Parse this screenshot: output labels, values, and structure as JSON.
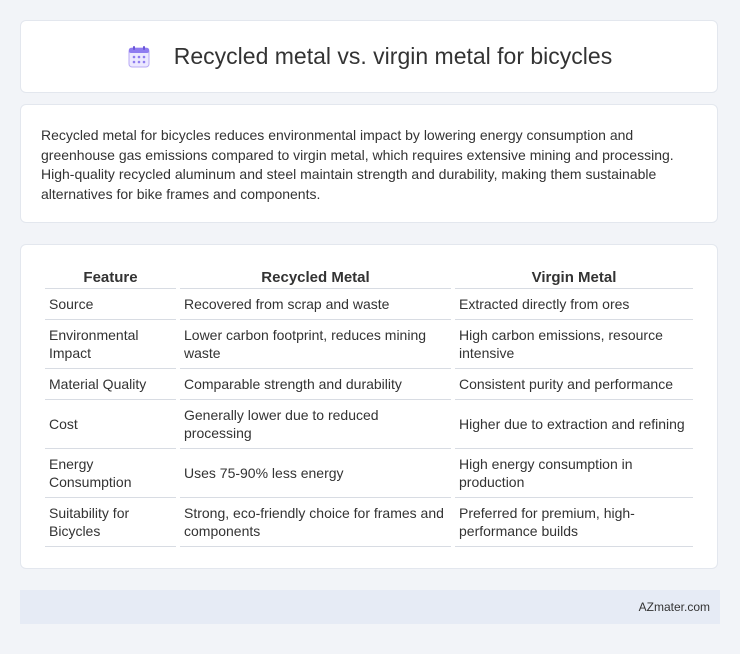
{
  "header": {
    "title": "Recycled metal vs. virgin metal for bicycles",
    "icon": "calendar-icon",
    "icon_color": "#7b61ff"
  },
  "summary": {
    "text": "Recycled metal for bicycles reduces environmental impact by lowering energy consumption and greenhouse gas emissions compared to virgin metal, which requires extensive mining and processing. High-quality recycled aluminum and steel maintain strength and durability, making them sustainable alternatives for bike frames and components."
  },
  "table": {
    "columns": [
      "Feature",
      "Recycled Metal",
      "Virgin Metal"
    ],
    "rows": [
      {
        "feature": "Source",
        "recycled": "Recovered from scrap and waste",
        "virgin": "Extracted directly from ores"
      },
      {
        "feature": "Environmental Impact",
        "recycled": "Lower carbon footprint, reduces mining waste",
        "virgin": "High carbon emissions, resource intensive"
      },
      {
        "feature": "Material Quality",
        "recycled": "Comparable strength and durability",
        "virgin": "Consistent purity and performance"
      },
      {
        "feature": "Cost",
        "recycled": "Generally lower due to reduced processing",
        "virgin": "Higher due to extraction and refining"
      },
      {
        "feature": "Energy Consumption",
        "recycled": "Uses 75-90% less energy",
        "virgin": "High energy consumption in production"
      },
      {
        "feature": "Suitability for Bicycles",
        "recycled": "Strong, eco-friendly choice for frames and components",
        "virgin": "Preferred for premium, high-performance builds"
      }
    ]
  },
  "footer": {
    "brand": "AZmater.com"
  }
}
